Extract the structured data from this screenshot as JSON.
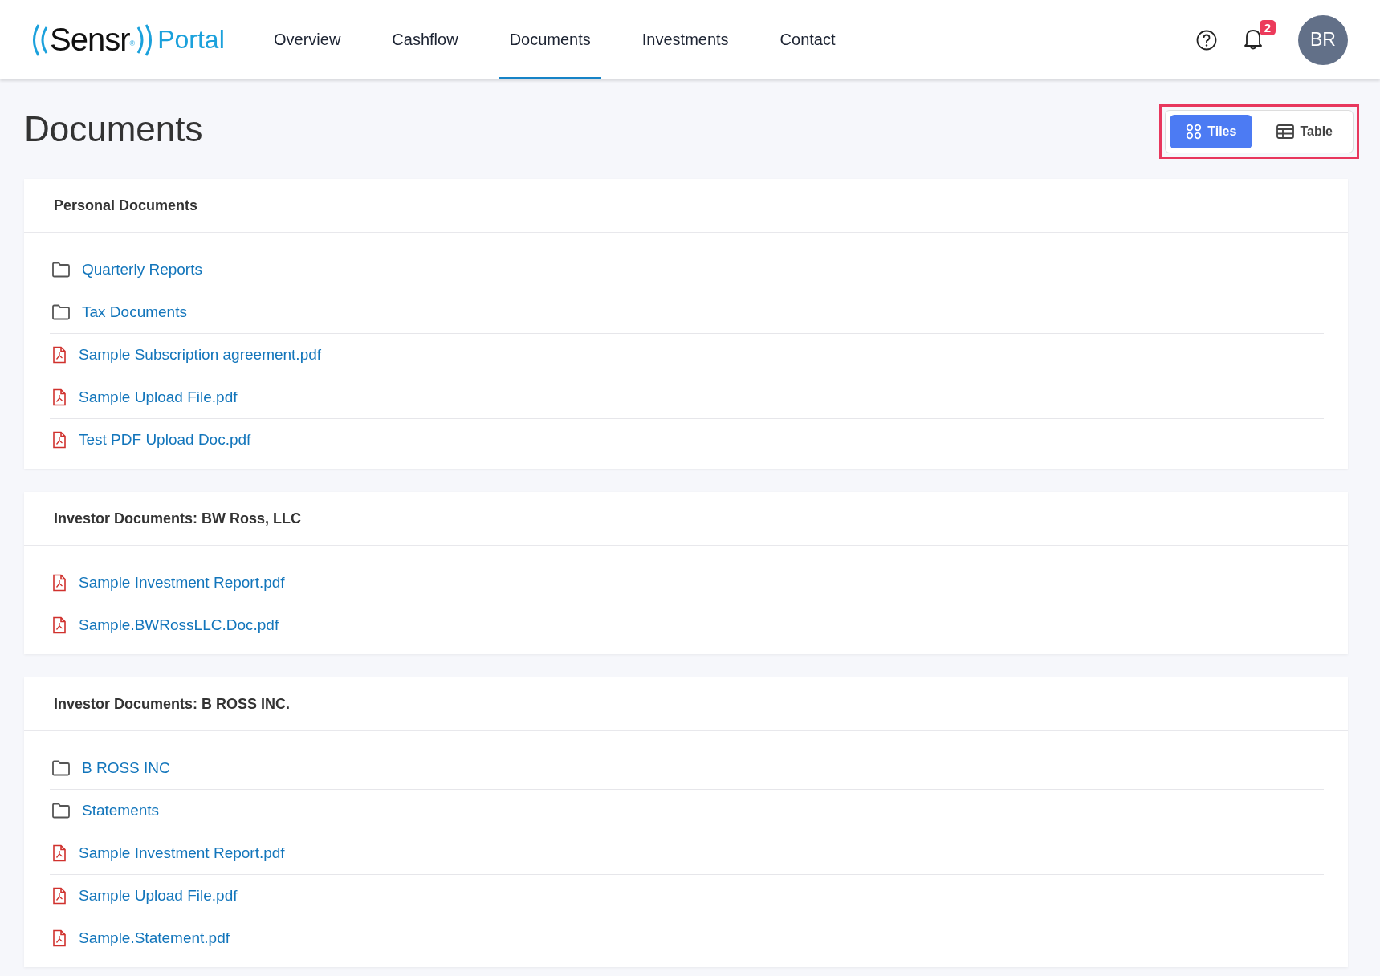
{
  "logo": {
    "name": "Sensr",
    "mark": "®",
    "product": "Portal"
  },
  "nav": [
    {
      "label": "Overview",
      "selected": false
    },
    {
      "label": "Cashflow",
      "selected": false
    },
    {
      "label": "Documents",
      "selected": true
    },
    {
      "label": "Investments",
      "selected": false
    },
    {
      "label": "Contact",
      "selected": false
    }
  ],
  "notifications": {
    "count": "2"
  },
  "avatar": {
    "initials": "BR"
  },
  "page_title": "Documents",
  "view_toggle": {
    "highlighted": true,
    "options": [
      {
        "label": "Tiles",
        "kind": "tiles",
        "selected": true
      },
      {
        "label": "Table",
        "kind": "table",
        "selected": false
      }
    ]
  },
  "sections": [
    {
      "title": "Personal Documents",
      "items": [
        {
          "kind": "folder",
          "name": "Quarterly Reports"
        },
        {
          "kind": "folder",
          "name": "Tax Documents"
        },
        {
          "kind": "pdf",
          "name": "Sample Subscription agreement.pdf"
        },
        {
          "kind": "pdf",
          "name": "Sample Upload File.pdf"
        },
        {
          "kind": "pdf",
          "name": "Test PDF Upload Doc.pdf"
        }
      ]
    },
    {
      "title": "Investor Documents: BW Ross, LLC",
      "items": [
        {
          "kind": "pdf",
          "name": "Sample Investment Report.pdf"
        },
        {
          "kind": "pdf",
          "name": "Sample.BWRossLLC.Doc.pdf"
        }
      ]
    },
    {
      "title": "Investor Documents: B ROSS INC.",
      "items": [
        {
          "kind": "folder",
          "name": "B ROSS INC"
        },
        {
          "kind": "folder",
          "name": "Statements"
        },
        {
          "kind": "pdf",
          "name": "Sample Investment Report.pdf"
        },
        {
          "kind": "pdf",
          "name": "Sample Upload File.pdf"
        },
        {
          "kind": "pdf",
          "name": "Sample.Statement.pdf"
        }
      ]
    }
  ]
}
